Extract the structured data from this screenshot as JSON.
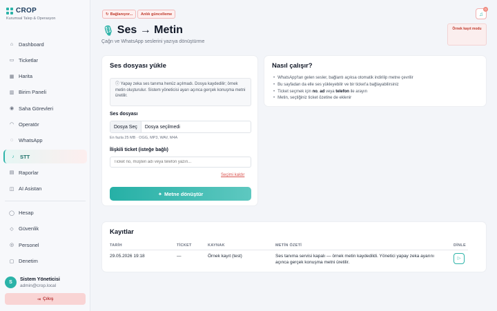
{
  "brand": {
    "name": "CROP",
    "subtitle": "Kurumsal Talep & Operasyon"
  },
  "nav": {
    "main": [
      {
        "label": "Dashboard",
        "icon": "dashboard-icon",
        "glyph": "⌂"
      },
      {
        "label": "Ticketlar",
        "icon": "ticket-icon",
        "glyph": "▭"
      },
      {
        "label": "Harita",
        "icon": "map-icon",
        "glyph": "▦"
      },
      {
        "label": "Birim Paneli",
        "icon": "building-icon",
        "glyph": "▥"
      },
      {
        "label": "Saha Görevleri",
        "icon": "location-pin-icon",
        "glyph": "◉"
      },
      {
        "label": "Operatör",
        "icon": "headset-icon",
        "glyph": "◠"
      },
      {
        "label": "WhatsApp",
        "icon": "whatsapp-icon",
        "glyph": "◌"
      },
      {
        "label": "STT",
        "icon": "microphone-icon",
        "glyph": "♪",
        "active": true
      },
      {
        "label": "Raporlar",
        "icon": "chart-icon",
        "glyph": "▤"
      },
      {
        "label": "AI Asistan",
        "icon": "robot-icon",
        "glyph": "◫"
      }
    ],
    "secondary": [
      {
        "label": "Hesap",
        "icon": "user-icon",
        "glyph": "◯"
      },
      {
        "label": "Güvenlik",
        "icon": "shield-icon",
        "glyph": "◇"
      },
      {
        "label": "Personel",
        "icon": "users-icon",
        "glyph": "◎"
      },
      {
        "label": "Denetim",
        "icon": "clipboard-icon",
        "glyph": "▢"
      }
    ]
  },
  "user": {
    "initial": "S",
    "name": "Sistem Yöneticisi",
    "email": "admin@crop.local"
  },
  "logout_label": "Çıkış",
  "status": {
    "connecting": "Bağlanıyor...",
    "live": "Anlık güncelleme"
  },
  "notifications_count": "0",
  "sample_mode": "Örnek kayıt modu",
  "page": {
    "title": "Ses → Metin",
    "subtitle": "Çağrı ve WhatsApp seslerini yazıya dönüştürme"
  },
  "upload": {
    "title": "Ses dosyası yükle",
    "info": "Yapay zeka ses tanıma henüz açılmadı. Dosya kaydedilir; örnek metin oluşturulur. Sistem yöneticisi ayarı açınca gerçek konuşma metni üretilir.",
    "file_label": "Ses dosyası",
    "file_button": "Dosya Seç",
    "file_status": "Dosya seçilmedi",
    "file_hint": "En fazla 25 MB · OGG, MP3, WAV, M4A",
    "ticket_label": "İlişkili ticket (isteğe bağlı)",
    "ticket_placeholder": "Ticket no, müşteri adı veya telefon yazın...",
    "clear_link": "Seçimi kaldır",
    "submit_label": "Metne dönüştür"
  },
  "how": {
    "title": "Nasıl çalışır?",
    "items": [
      {
        "text": "WhatsApp'tan gelen sesler, bağlantı açıksa otomatik indirilip metne çevrilir"
      },
      {
        "text": "Bu sayfadan da elle ses yükleyebilir ve bir ticket'a bağlayabilirsiniz"
      },
      {
        "pre": "Ticket seçmek için ",
        "b1": "no",
        "mid1": ", ",
        "b2": "ad",
        "mid2": " veya ",
        "b3": "telefon",
        "post": " ile arayın"
      },
      {
        "text": "Metin, seçtiğiniz ticket özetine de eklenir"
      }
    ]
  },
  "records": {
    "title": "Kayıtlar",
    "columns": [
      "TARİH",
      "TİCKET",
      "KAYNAK",
      "METİN ÖZETİ",
      "DİNLE"
    ],
    "rows": [
      {
        "date": "29.05.2026 19:18",
        "ticket": "—",
        "source": "Örnek kayıt (test)",
        "summary": "Ses tanıma servisi kapalı — örnek metin kaydedildi. Yönetici yapay zeka ayarını açınca gerçek konuşma metni üretilir."
      }
    ]
  },
  "colors": {
    "accent": "#2bb3a8",
    "danger": "#c0392b",
    "background": "#f3f5f9"
  }
}
